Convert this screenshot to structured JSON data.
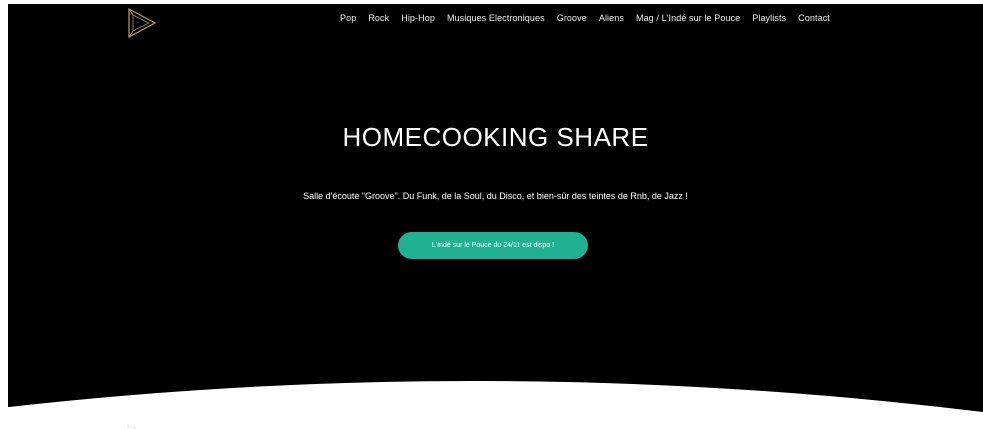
{
  "header": {
    "logo_icon": "play-triangle-logo",
    "nav_items": [
      {
        "label": "Pop"
      },
      {
        "label": "Rock"
      },
      {
        "label": "Hip-Hop"
      },
      {
        "label": "Musiques Electroniques"
      },
      {
        "label": "Groove"
      },
      {
        "label": "Aliens"
      },
      {
        "label": "Mag / L'Indé sur le Pouce"
      },
      {
        "label": "Playlists"
      },
      {
        "label": "Contact"
      }
    ]
  },
  "hero": {
    "title": "HOMECOOKING SHARE",
    "subtitle": "Salle d'écoute \"Groove\". Du Funk, de la Soul, du Disco, et bien-sûr des teintes de Rnb, de Jazz !",
    "cta_label": "L'Indé sur le Pouce du 24/11 est dispo !"
  },
  "colors": {
    "background": "#000000",
    "accent": "#1fb191",
    "text": "#ffffff",
    "wave": "#ffffff"
  }
}
